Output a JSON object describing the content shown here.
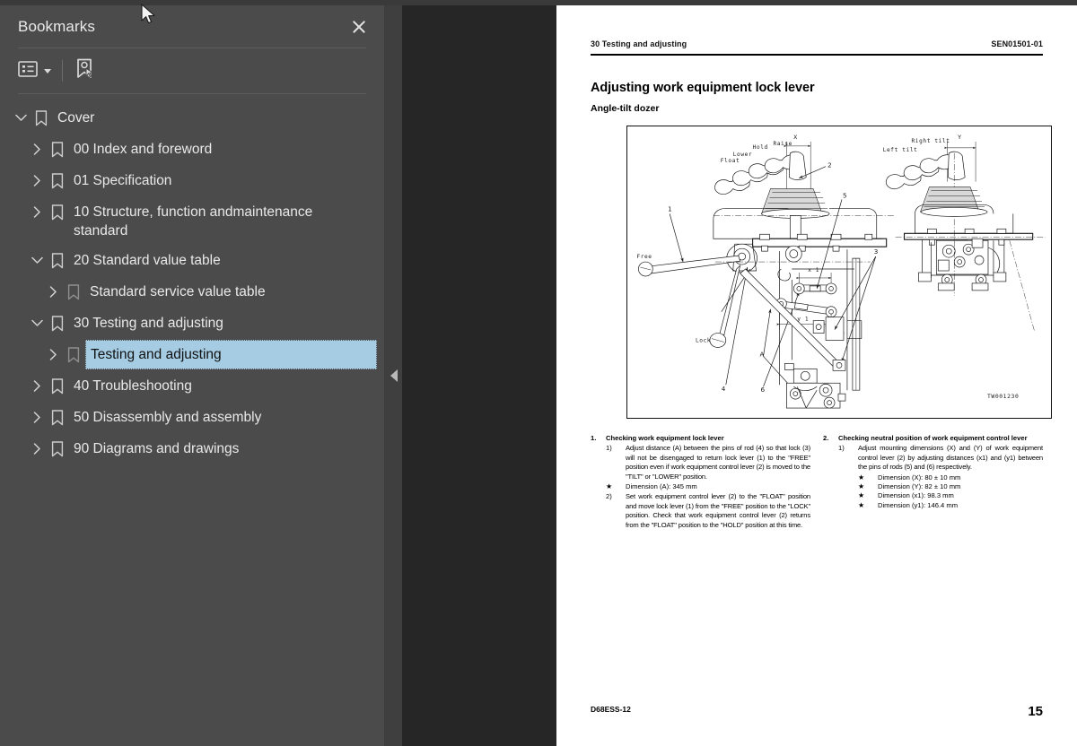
{
  "sidebar": {
    "title": "Bookmarks",
    "close_icon": "close-icon",
    "toolbar": {
      "options_icon": "list-options-icon",
      "dropdown_icon": "chevron-down-icon",
      "new_bookmark_icon": "new-bookmark-icon"
    },
    "tree": [
      {
        "label": "Cover",
        "level": 0,
        "state": "expanded",
        "selected": false
      },
      {
        "label": "00 Index and foreword",
        "level": 1,
        "state": "collapsed",
        "selected": false
      },
      {
        "label": "01 Specification",
        "level": 1,
        "state": "collapsed",
        "selected": false
      },
      {
        "label": "10 Structure, function andmaintenance standard",
        "level": 1,
        "state": "collapsed",
        "selected": false
      },
      {
        "label": "20 Standard value table",
        "level": 1,
        "state": "expanded",
        "selected": false
      },
      {
        "label": "Standard service value table",
        "level": 2,
        "state": "collapsed",
        "selected": false
      },
      {
        "label": "30 Testing and adjusting",
        "level": 1,
        "state": "expanded",
        "selected": false
      },
      {
        "label": "Testing and adjusting",
        "level": 2,
        "state": "collapsed",
        "selected": true
      },
      {
        "label": "40 Troubleshooting",
        "level": 1,
        "state": "collapsed",
        "selected": false
      },
      {
        "label": "50 Disassembly and assembly",
        "level": 1,
        "state": "collapsed",
        "selected": false
      },
      {
        "label": "90 Diagrams and drawings",
        "level": 1,
        "state": "collapsed",
        "selected": false
      }
    ],
    "collapse_handle_icon": "collapse-panel-icon"
  },
  "document": {
    "running_head_left": "30 Testing and adjusting",
    "running_head_right": "SEN01501-01",
    "heading": "Adjusting work equipment lock lever",
    "subheading": "Angle-tilt dozer",
    "figure": {
      "id": "TW001230",
      "labels": {
        "float": "Float",
        "lower": "Lower",
        "hold": "Hold",
        "raise": "Raise",
        "left_tilt": "Left tilt",
        "right_tilt": "Right tilt",
        "free": "Free",
        "lock": "Lock",
        "dim_x": "X",
        "dim_y": "Y",
        "dim_x1": "x 1",
        "dim_y1": "y 1",
        "dim_a": "A",
        "callout_1": "1",
        "callout_2": "2",
        "callout_3": "3",
        "callout_4": "4",
        "callout_5": "5",
        "callout_6": "6"
      }
    },
    "column_left": {
      "num": "1.",
      "heading": "Checking work equipment lock lever",
      "step1_num": "1)",
      "step1_text": "Adjust distance (A) between the pins of rod (4) so that lock (3) will not be disengaged to return lock lever (1) to the \"FREE\" position even if work equipment control lever (2) is moved to the \"TILT\" or \"LOWER\" position.",
      "star1": "Dimension (A): 345 mm",
      "step2_num": "2)",
      "step2_text": "Set work equipment control lever (2) to the \"FLOAT\" position and move lock lever (1) from the \"FREE\" position to the \"LOCK\" position. Check that work equipment control lever (2) returns from the \"FLOAT\" position to the \"HOLD\" position at this time."
    },
    "column_right": {
      "num": "2.",
      "heading": "Checking neutral position of work equipment control lever",
      "step1_num": "1)",
      "step1_text": "Adjust mounting dimensions (X) and (Y) of work equipment control lever (2) by adjusting distances (x1) and (y1) between the pins of rods (5) and (6) respectively.",
      "stars": [
        "Dimension (X): 80 ± 10 mm",
        "Dimension (Y): 82 ± 10 mm",
        "Dimension (x1): 98.3 mm",
        "Dimension (y1): 146.4 mm"
      ]
    },
    "footer_left": "D68ESS-12",
    "footer_right": "15"
  },
  "colors": {
    "sidebar_bg": "#4b4b4b",
    "gutter_bg": "#3f3f3f",
    "viewer_bg": "#262626",
    "selection": "#a5cce3",
    "text": "#e9e9e9"
  },
  "cursor": {
    "icon": "mouse-pointer-icon"
  }
}
